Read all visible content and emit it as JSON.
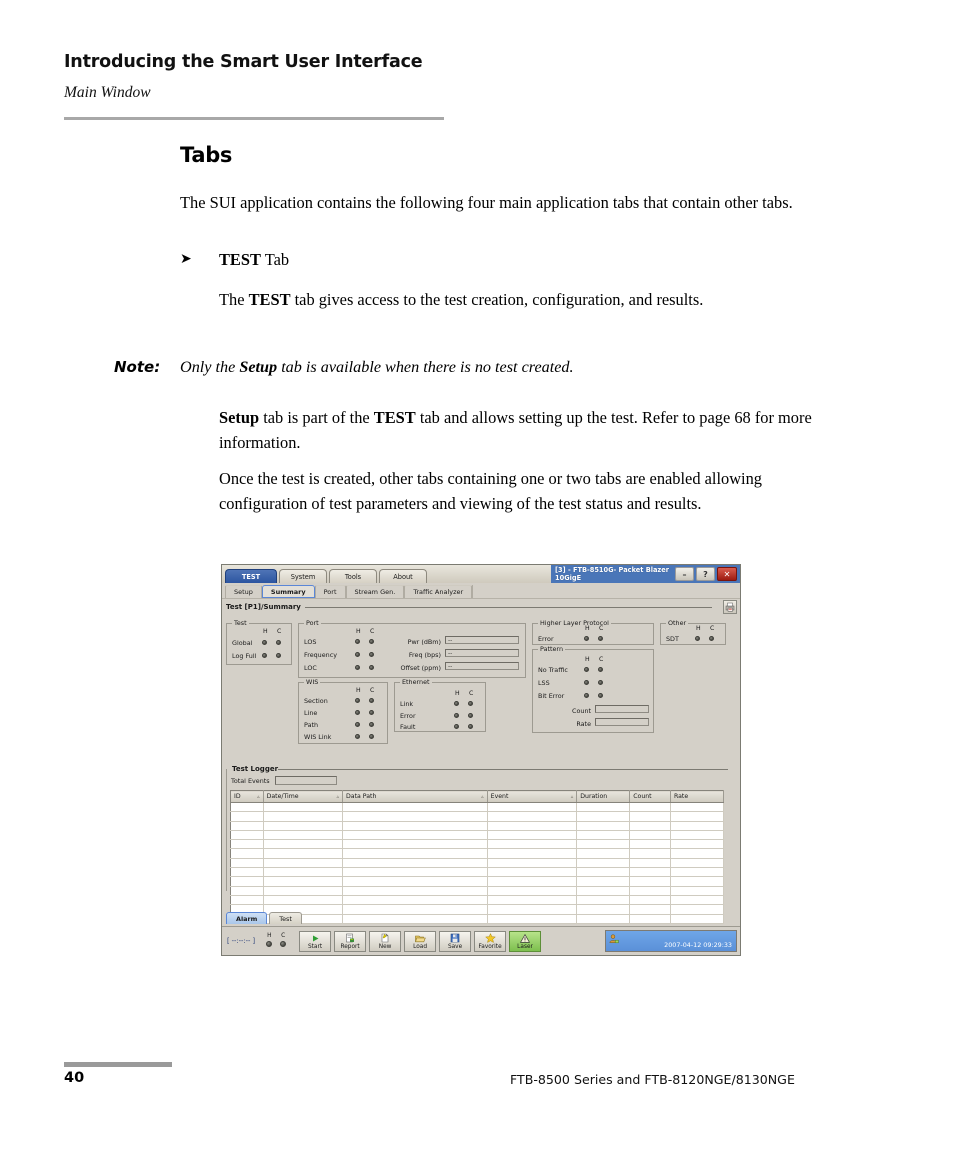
{
  "page": {
    "header_title": "Introducing the Smart User Interface",
    "header_subtitle": "Main Window",
    "section_title": "Tabs",
    "intro": "The SUI application contains the following four main application tabs that contain other tabs.",
    "bullet_bold": "TEST",
    "bullet_rest": " Tab",
    "bullet_arrow": "➤",
    "sub_para_1_a": "The ",
    "sub_para_1_b": "TEST",
    "sub_para_1_c": " tab gives access to the test creation, configuration, and results.",
    "note_label": "Note:",
    "note_a": "Only the ",
    "note_b": "Setup",
    "note_c": " tab is available when there is no test created.",
    "setup_a": "Setup",
    "setup_b": " tab is part of the ",
    "setup_c": "TEST",
    "setup_d": " tab and allows setting up the test. Refer to page 68 for more information.",
    "once_para": "Once the test is created, other tabs containing one or two tabs are enabled allowing configuration of test parameters and viewing of the test status and results.",
    "footer_page": "40",
    "footer_text": "FTB-8500 Series and FTB-8120NGE/8130NGE"
  },
  "app": {
    "window_title_line1": "[3] - FTB-8510G- Packet Blazer",
    "window_title_line2": "10GigE",
    "window_buttons": {
      "minimize": "–",
      "help": "?",
      "close": "✕"
    },
    "main_tabs": [
      {
        "label": "TEST",
        "active": true
      },
      {
        "label": "System",
        "active": false
      },
      {
        "label": "Tools",
        "active": false
      },
      {
        "label": "About",
        "active": false
      }
    ],
    "sub_tabs": [
      {
        "label": "Setup",
        "active": false
      },
      {
        "label": "Summary",
        "active": true
      },
      {
        "label": "Port",
        "active": false
      },
      {
        "label": "Stream Gen.",
        "active": false
      },
      {
        "label": "Traffic Analyzer",
        "active": false
      }
    ],
    "breadcrumb": "Test [P1]/Summary",
    "hc_header": {
      "h": "H",
      "c": "C"
    },
    "groups": {
      "test": {
        "legend": "Test",
        "rows": [
          "Global",
          "Log Full"
        ]
      },
      "port": {
        "legend": "Port",
        "rows": [
          "LOS",
          "Frequency",
          "LOC"
        ],
        "fields": [
          {
            "label": "Pwr (dBm)",
            "value": "--"
          },
          {
            "label": "Freq (bps)",
            "value": "--"
          },
          {
            "label": "Offset (ppm)",
            "value": "--"
          }
        ]
      },
      "wis": {
        "legend": "WIS",
        "rows": [
          "Section",
          "Line",
          "Path",
          "WIS Link"
        ]
      },
      "ethernet": {
        "legend": "Ethernet",
        "rows": [
          "Link",
          "Error",
          "Fault"
        ]
      },
      "higher_layer": {
        "legend": "Higher Layer Protocol",
        "rows": [
          "Error"
        ]
      },
      "pattern": {
        "legend": "Pattern",
        "rows": [
          "No Traffic",
          "LSS",
          "Bit Error"
        ],
        "fields": [
          {
            "label": "Count",
            "value": ""
          },
          {
            "label": "Rate",
            "value": ""
          }
        ]
      },
      "other": {
        "legend": "Other",
        "rows": [
          "SDT"
        ]
      }
    },
    "logger": {
      "legend": "Test Logger",
      "total_label": "Total Events",
      "total_value": "",
      "columns": [
        {
          "label": "ID",
          "sortable": true
        },
        {
          "label": "Date/Time",
          "sortable": true
        },
        {
          "label": "Data Path",
          "sortable": true
        },
        {
          "label": "Event",
          "sortable": true
        },
        {
          "label": "Duration",
          "sortable": false
        },
        {
          "label": "Count",
          "sortable": false
        },
        {
          "label": "Rate",
          "sortable": false
        }
      ],
      "rows": [],
      "empty_row_count": 13,
      "sort_marker": "▵"
    },
    "bottom_tabs": [
      {
        "label": "Alarm",
        "active": true
      },
      {
        "label": "Test",
        "active": false
      }
    ],
    "status": {
      "timer": "[ --:--:-- ]",
      "hc_h": "H",
      "hc_c": "C",
      "timestamp": "2007-04-12 09:29:33"
    },
    "toolbar_buttons": [
      {
        "label": "Start",
        "icon": "play-icon"
      },
      {
        "label": "Report",
        "icon": "report-icon"
      },
      {
        "label": "New",
        "icon": "new-document-icon"
      },
      {
        "label": "Load",
        "icon": "folder-open-icon"
      },
      {
        "label": "Save",
        "icon": "floppy-disk-icon"
      },
      {
        "label": "Favorite",
        "icon": "star-icon"
      },
      {
        "label": "Laser",
        "icon": "warning-triangle-icon"
      }
    ],
    "colors": {
      "face": "#d4d0c8",
      "accent_blue": "#2c55a0",
      "status_blue": "#5b90d8",
      "laser_green": "#7dbf4e",
      "close_red": "#9e1b12"
    }
  }
}
